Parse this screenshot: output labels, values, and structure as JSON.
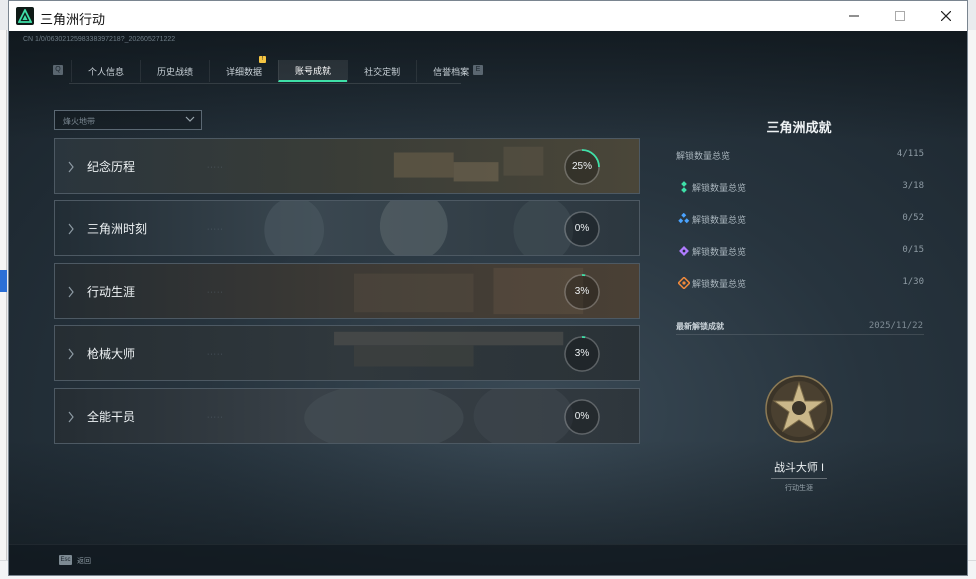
{
  "window": {
    "title": "三角洲行动",
    "build_id": "CN 1/0/0630212598338397218?_202605271222"
  },
  "tabs": [
    {
      "label": "个人信息"
    },
    {
      "label": "历史战绩"
    },
    {
      "label": "详细数据"
    },
    {
      "label": "账号成就",
      "active": true
    },
    {
      "label": "社交定制"
    },
    {
      "label": "信誉档案"
    }
  ],
  "filter": {
    "value": "烽火地带"
  },
  "categories": [
    {
      "label": "纪念历程",
      "percent": "25%",
      "progress": 0.25
    },
    {
      "label": "三角洲时刻",
      "percent": "0%",
      "progress": 0.0
    },
    {
      "label": "行动生涯",
      "percent": "3%",
      "progress": 0.03
    },
    {
      "label": "枪械大师",
      "percent": "3%",
      "progress": 0.03
    },
    {
      "label": "全能干员",
      "percent": "0%",
      "progress": 0.0
    }
  ],
  "summary": {
    "title": "三角洲成就",
    "total_label": "解锁数量总览",
    "total_value": "4/115",
    "rows": [
      {
        "label": "解锁数量总览",
        "value": "3/18",
        "color": "#3fe0a8",
        "icon": "tier-green-icon"
      },
      {
        "label": "解锁数量总览",
        "value": "0/52",
        "color": "#4aa3ff",
        "icon": "tier-blue-icon"
      },
      {
        "label": "解锁数量总览",
        "value": "0/15",
        "color": "#b07cff",
        "icon": "tier-purple-icon"
      },
      {
        "label": "解锁数量总览",
        "value": "1/30",
        "color": "#f08a3c",
        "icon": "tier-orange-icon"
      }
    ],
    "latest_label": "最新解锁成就",
    "latest_date": "2025/11/22",
    "medal_name": "战斗大师 I",
    "medal_category": "行动生涯"
  },
  "bottom": {
    "key": "Esc",
    "label": "返回"
  },
  "colors": {
    "accent": "#3fe0a8",
    "card_border": "#4d5963"
  }
}
